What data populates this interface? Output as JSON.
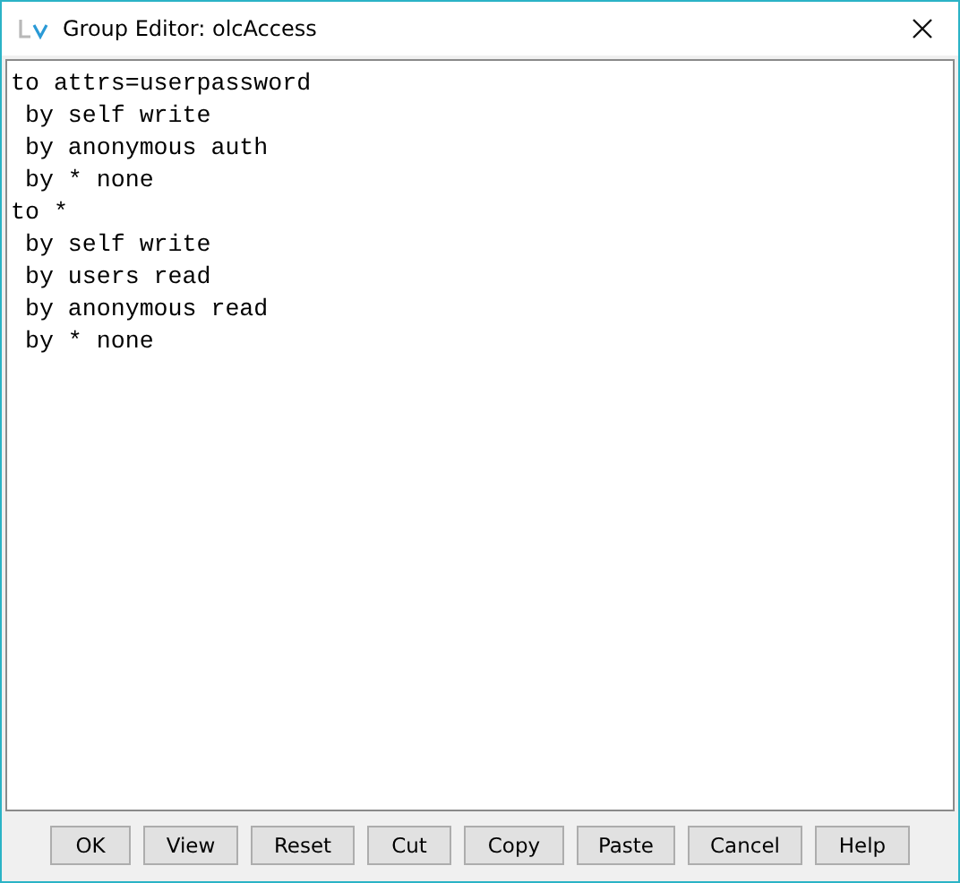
{
  "window": {
    "title": "Group Editor: olcAccess"
  },
  "editor": {
    "value": "to attrs=userpassword\n by self write\n by anonymous auth\n by * none\nto *\n by self write\n by users read\n by anonymous read\n by * none"
  },
  "buttons": [
    "OK",
    "View",
    "Reset",
    "Cut",
    "Copy",
    "Paste",
    "Cancel",
    "Help"
  ]
}
